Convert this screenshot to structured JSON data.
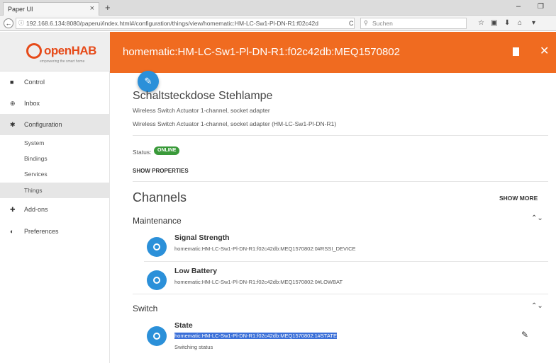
{
  "browser": {
    "tab_title": "Paper UI",
    "tab_close": "×",
    "new_tab": "+",
    "url": "192.168.6.134:8080/paperui/index.html#/configuration/things/view/homematic:HM-LC-Sw1-Pl-DN-R1:f02c42d",
    "search_placeholder": "Suchen"
  },
  "sidebar": {
    "logo_text": "openHAB",
    "logo_sub": "empowering the smart home",
    "items": [
      {
        "label": "Control",
        "icon": "grid-icon"
      },
      {
        "label": "Inbox",
        "icon": "plus-circle-icon"
      },
      {
        "label": "Configuration",
        "icon": "gear-icon"
      },
      {
        "label": "Add-ons",
        "icon": "puzzle-icon"
      },
      {
        "label": "Preferences",
        "icon": "toggle-icon"
      }
    ],
    "sub_items": [
      {
        "label": "System"
      },
      {
        "label": "Bindings"
      },
      {
        "label": "Services"
      },
      {
        "label": "Things"
      }
    ]
  },
  "header": {
    "title": "homematic:HM-LC-Sw1-Pl-DN-R1:f02c42db:MEQ1570802"
  },
  "thing": {
    "name": "Schaltsteckdose Stehlampe",
    "desc1": "Wireless Switch Actuator 1-channel, socket adapter",
    "desc2": "Wireless Switch Actuator 1-channel, socket adapter (HM-LC-Sw1-Pl-DN-R1)",
    "status_label": "Status:",
    "status_value": "ONLINE",
    "show_properties": "SHOW PROPERTIES"
  },
  "channels": {
    "title": "Channels",
    "show_more": "SHOW MORE",
    "groups": [
      {
        "name": "Maintenance",
        "items": [
          {
            "name": "Signal Strength",
            "uid": "homematic:HM-LC-Sw1-Pl-DN-R1:f02c42db:MEQ1570802:0#RSSI_DEVICE"
          },
          {
            "name": "Low Battery",
            "uid": "homematic:HM-LC-Sw1-Pl-DN-R1:f02c42db:MEQ1570802:0#LOWBAT"
          }
        ]
      },
      {
        "name": "Switch",
        "items": [
          {
            "name": "State",
            "uid": "homematic:HM-LC-Sw1-Pl-DN-R1:f02c42db:MEQ1570802:1#STATE",
            "desc": "Switching status"
          }
        ]
      }
    ]
  },
  "colors": {
    "accent": "#f06b20",
    "primary": "#2b90d9",
    "online": "#3a9a3a"
  }
}
